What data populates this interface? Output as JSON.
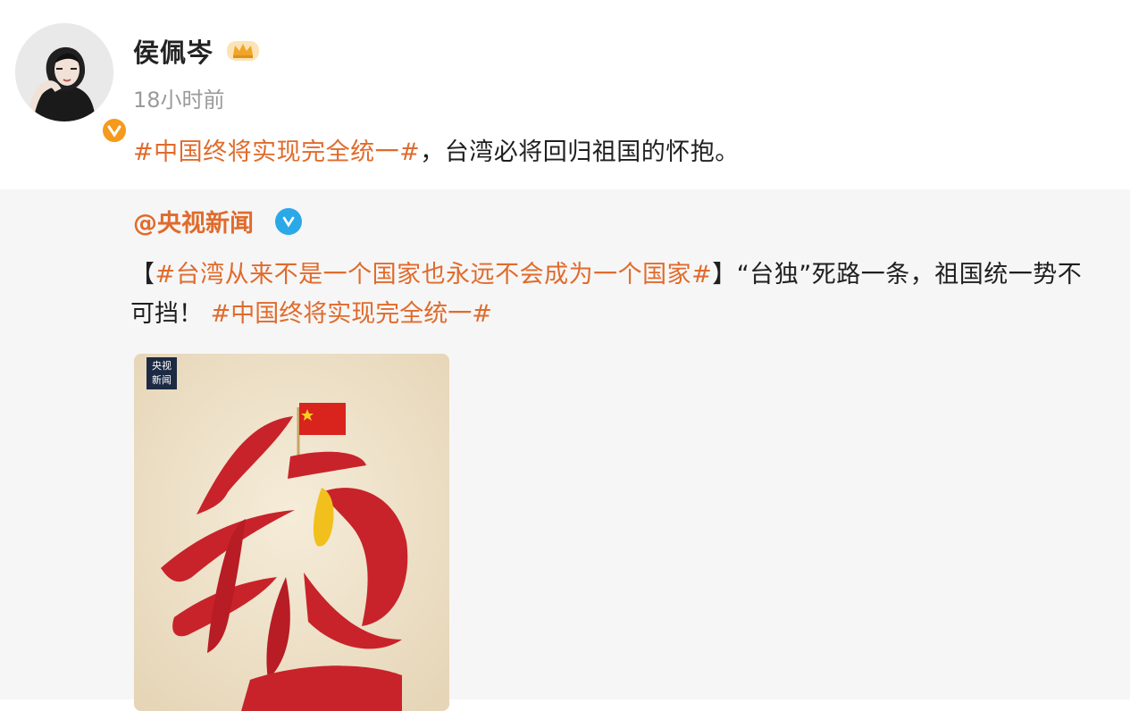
{
  "post": {
    "username": "侯佩岑",
    "timestamp": "18小时前",
    "hashtag": "#中国终将实现完全统一#",
    "text_rest": "，台湾必将回归祖国的怀抱。"
  },
  "repost": {
    "author": "@央视新闻",
    "bracket_open": "【",
    "hashtag_title": "#台湾从来不是一个国家也永远不会成为一个国家#",
    "bracket_close": "】",
    "text_main": "“台独”死路一条，祖国统一势不",
    "text_line2_start": "可挡！",
    "hashtag_end": "#中国终将实现完全统一#",
    "poster_logo_line1": "央视",
    "poster_logo_line2": "新闻"
  },
  "colors": {
    "hashtag": "#e06b2c",
    "verified_orange": "#f59a1b",
    "verified_blue": "#2aa8e8",
    "flag_red": "#d9231d",
    "calligraphy_red": "#c8232a",
    "taiwan_yellow": "#f2c01c",
    "poster_bg": "#efe4cf"
  },
  "icons": {
    "crown": "crown-icon",
    "orange_verify": "orange-verify-icon",
    "blue_verify": "blue-verify-icon",
    "flag": "china-flag-icon"
  }
}
